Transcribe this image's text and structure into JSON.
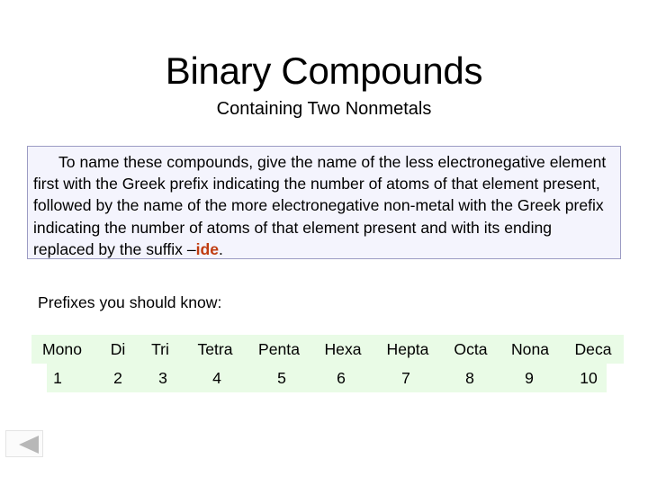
{
  "slide": {
    "title": "Binary Compounds",
    "subtitle": "Containing Two Nonmetals"
  },
  "info_box": {
    "text": "To name these compounds, give the name of the less electronegative element first with the Greek prefix indicating the number of atoms of that element present, followed by the name of the more electronegative non-metal with the Greek prefix indicating the number of atoms of that element present and with its ending replaced by the suffix –",
    "suffix": "ide",
    "end": "."
  },
  "prefixes": {
    "heading": "Prefixes you should know:",
    "items": [
      {
        "name": "Mono",
        "number": "1"
      },
      {
        "name": "Di",
        "number": "2"
      },
      {
        "name": "Tri",
        "number": "3"
      },
      {
        "name": "Tetra",
        "number": "4"
      },
      {
        "name": "Penta",
        "number": "5"
      },
      {
        "name": "Hexa",
        "number": "6"
      },
      {
        "name": "Hepta",
        "number": "7"
      },
      {
        "name": "Octa",
        "number": "8"
      },
      {
        "name": "Nona",
        "number": "9"
      },
      {
        "name": "Deca",
        "number": "10"
      }
    ]
  },
  "navigation": {
    "back_icon": "triangle-left-icon"
  },
  "colors": {
    "suffix": "#c03c10",
    "box_background": "#f4f4fd",
    "box_border": "#9c9cc4",
    "table_background": "#e9fbe6"
  }
}
